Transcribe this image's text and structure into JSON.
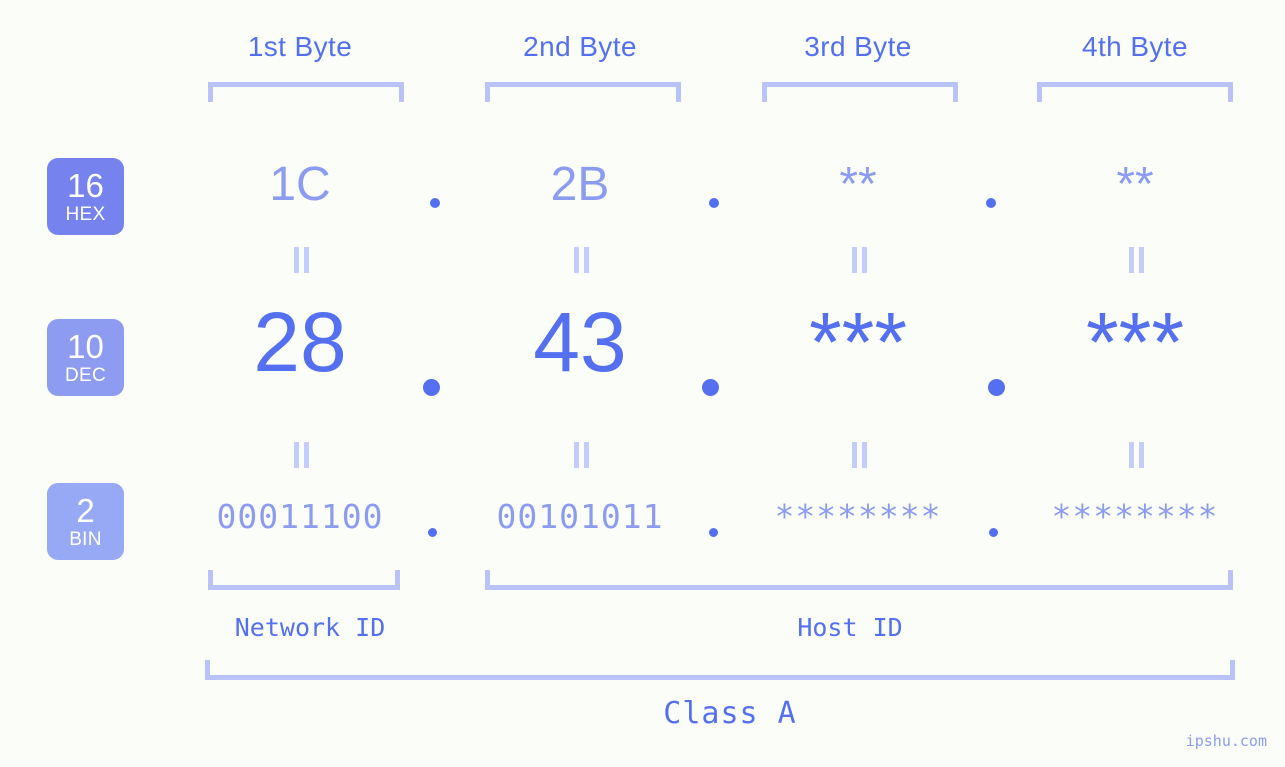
{
  "meta": {
    "watermark": "ipshu.com",
    "background_color": "#fbfdf8",
    "accent_strong": "#5470f0",
    "accent_mid": "#8c9cf0",
    "accent_light": "#b9c3f9"
  },
  "byte_headers": [
    {
      "label": "1st Byte"
    },
    {
      "label": "2nd Byte"
    },
    {
      "label": "3rd Byte"
    },
    {
      "label": "4th Byte"
    }
  ],
  "radix_badges": [
    {
      "num": "16",
      "label": "HEX",
      "color": "#7683ee"
    },
    {
      "num": "10",
      "label": "DEC",
      "color": "#8d9bf0"
    },
    {
      "num": "2",
      "label": "BIN",
      "color": "#97a8f5"
    }
  ],
  "rows": {
    "hex": {
      "values": [
        "1C",
        "2B",
        "**",
        "**"
      ],
      "separator": "."
    },
    "dec": {
      "values": [
        "28",
        "43",
        "***",
        "***"
      ],
      "separator": "."
    },
    "bin": {
      "values": [
        "00011100",
        "00101011",
        "********",
        "********"
      ],
      "separator": "."
    }
  },
  "equals_symbol": "=",
  "id_sections": [
    {
      "label": "Network ID"
    },
    {
      "label": "Host ID"
    }
  ],
  "class_label": "Class A"
}
